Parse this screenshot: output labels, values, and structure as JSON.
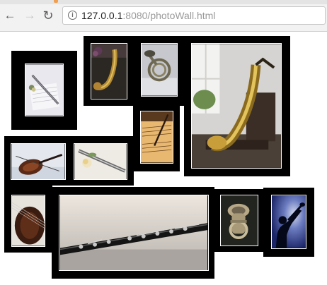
{
  "browser": {
    "url_host": "127.0.0.1",
    "url_rest": ":8080/photoWall.html",
    "back_icon": "arrow-left-icon",
    "forward_icon": "arrow-right-icon",
    "reload_icon": "reload-icon",
    "info_icon": "info-icon"
  },
  "photo_wall": {
    "photos": [
      {
        "subject": "flute-on-sheet-music"
      },
      {
        "subject": "saxophone-small"
      },
      {
        "subject": "french-horn"
      },
      {
        "subject": "saxophone-on-chair"
      },
      {
        "subject": "sheet-music-with-pen"
      },
      {
        "subject": "violin"
      },
      {
        "subject": "flute-with-flower"
      },
      {
        "subject": "violin-closeup"
      },
      {
        "subject": "clarinet"
      },
      {
        "subject": "tuba"
      },
      {
        "subject": "trumpet-player-silhouette"
      }
    ]
  }
}
